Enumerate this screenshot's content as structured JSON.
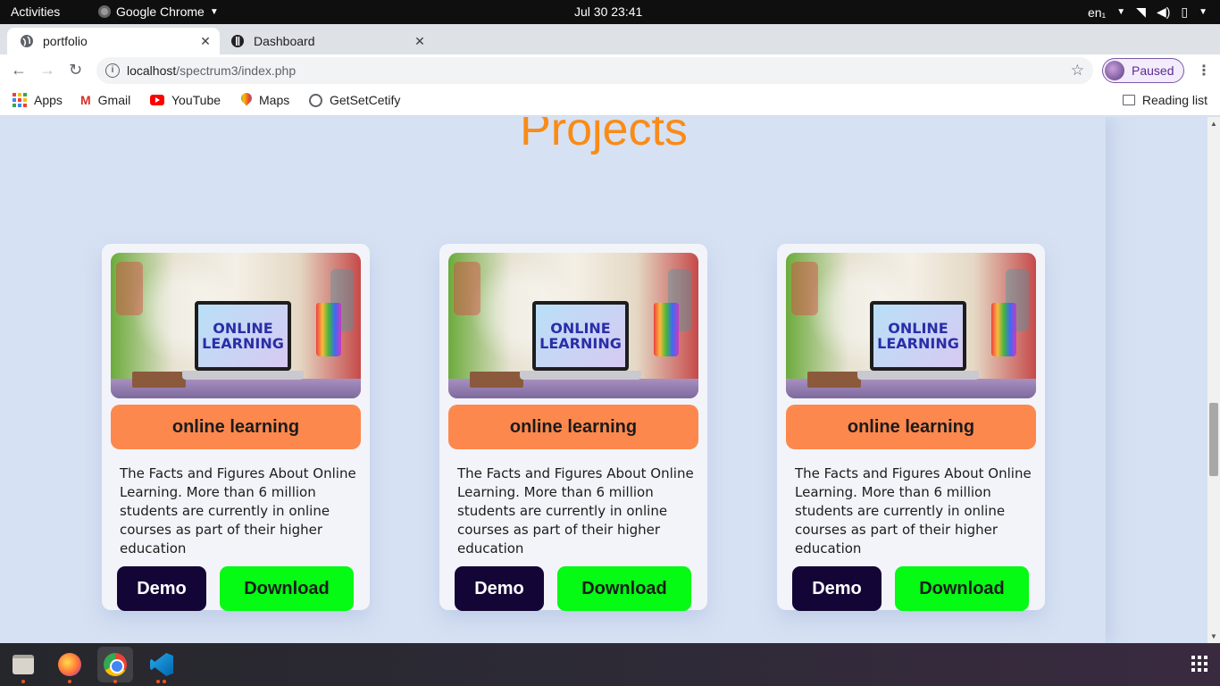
{
  "topbar": {
    "activities": "Activities",
    "app_name": "Google Chrome",
    "clock": "Jul 30  23:41",
    "lang": "en₁"
  },
  "tabs": [
    {
      "title": "portfolio",
      "active": true
    },
    {
      "title": "Dashboard",
      "active": false
    }
  ],
  "address": {
    "host": "localhost",
    "path": "/spectrum3/index.php"
  },
  "profile": {
    "label": "Paused"
  },
  "bookmarks": {
    "items": [
      {
        "label": "Apps",
        "icon": "apps-grid-icon"
      },
      {
        "label": "Gmail",
        "icon": "gmail-icon"
      },
      {
        "label": "YouTube",
        "icon": "youtube-icon"
      },
      {
        "label": "Maps",
        "icon": "maps-icon"
      },
      {
        "label": "GetSetCetify",
        "icon": "globe-icon"
      }
    ],
    "reading_list": "Reading list"
  },
  "page": {
    "heading": "Projects",
    "cards": [
      {
        "image_text": "ONLINE LEARNING",
        "title": "online learning",
        "description": "The Facts and Figures About Online Learning. More than 6 million students are currently in online courses as part of their higher education",
        "demo_label": "Demo",
        "download_label": "Download"
      },
      {
        "image_text": "ONLINE LEARNING",
        "title": "online learning",
        "description": "The Facts and Figures About Online Learning. More than 6 million students are currently in online courses as part of their higher education",
        "demo_label": "Demo",
        "download_label": "Download"
      },
      {
        "image_text": "ONLINE LEARNING",
        "title": "online learning",
        "description": "The Facts and Figures About Online Learning. More than 6 million students are currently in online courses as part of their higher education",
        "demo_label": "Demo",
        "download_label": "Download"
      }
    ]
  },
  "colors": {
    "heading": "#f98b17",
    "card_label_bg": "#fd884d",
    "demo_bg": "#130636",
    "download_bg": "#05fa14",
    "page_bg": "#d6e1f3"
  },
  "dock": {
    "items": [
      "files-icon",
      "firefox-icon",
      "chrome-icon",
      "vscode-icon"
    ]
  }
}
